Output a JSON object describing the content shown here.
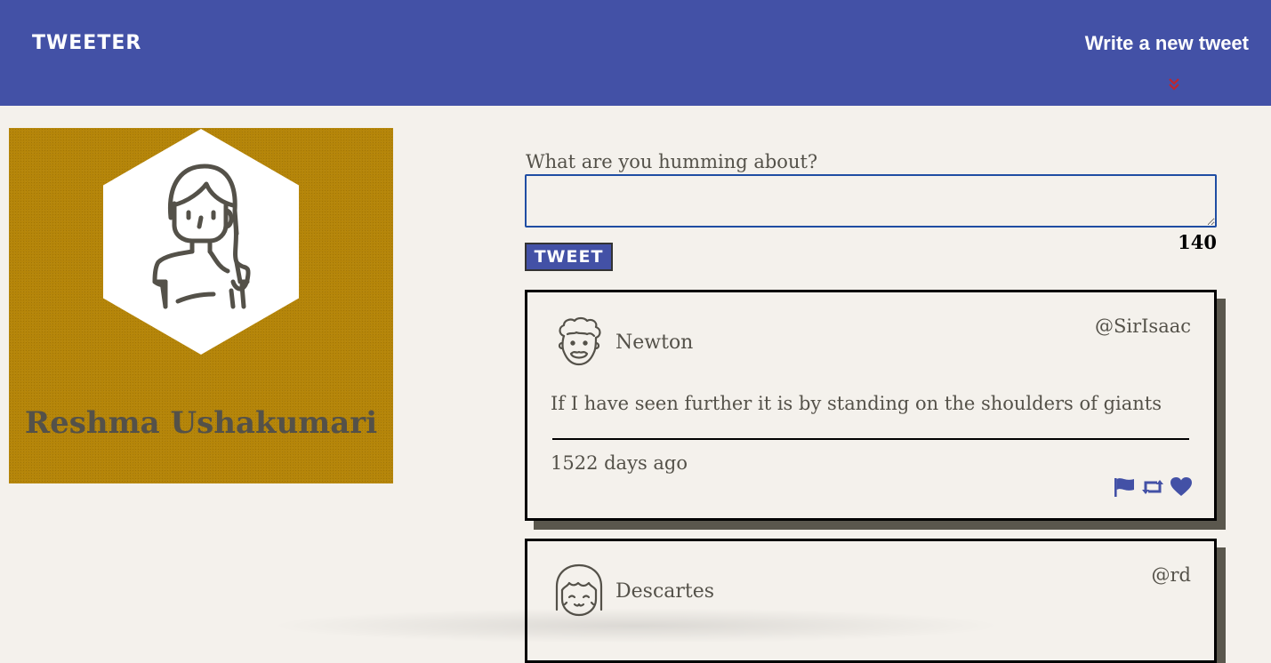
{
  "nav": {
    "brand": "TWEETER",
    "compose_link": "Write a new tweet",
    "chevron_icon": "double-chevron-down-icon",
    "chevron_color": "#c0262c",
    "background": "#4351a6"
  },
  "profile": {
    "name": "Reshma Ushakumari",
    "avatar_icon": "woman-avatar-icon",
    "background": "#b58509"
  },
  "compose": {
    "label": "What are you humming about?",
    "value": "",
    "placeholder": "",
    "button_label": "TWEET",
    "counter": "140"
  },
  "tweets": [
    {
      "name": "Newton",
      "handle": "@SirIsaac",
      "avatar_icon": "man-curly-hair-avatar-icon",
      "content": "If I have seen further it is by standing on the shoulders of giants",
      "time": "1522 days ago",
      "actions": [
        "flag-icon",
        "retweet-icon",
        "heart-icon"
      ]
    },
    {
      "name": "Descartes",
      "handle": "@rd",
      "avatar_icon": "bob-hair-avatar-icon"
    }
  ],
  "colors": {
    "accent": "#4351a6",
    "page_background": "#f4f1ec",
    "text": "#545149",
    "shadow": "#5a574d"
  }
}
